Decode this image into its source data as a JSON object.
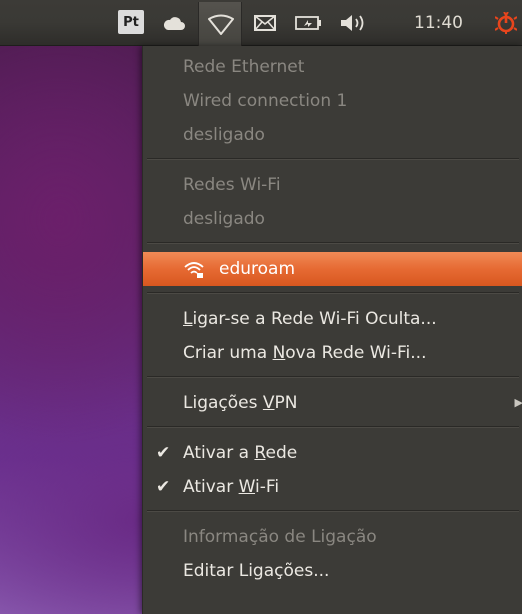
{
  "panel": {
    "indicators": [
      {
        "name": "keyboard-layout",
        "label": "Pt"
      },
      {
        "name": "cloud-icon"
      },
      {
        "name": "network-icon"
      },
      {
        "name": "mail-icon"
      },
      {
        "name": "battery-icon"
      },
      {
        "name": "volume-icon"
      },
      {
        "name": "session-icon"
      }
    ],
    "clock": "11:40",
    "colors": {
      "panel": "#3c3b37",
      "session": "#e8451c"
    }
  },
  "menu": {
    "ethernet_header": "Rede Ethernet",
    "ethernet_name": "Wired connection 1",
    "ethernet_status": "desligado",
    "wifi_header": "Redes Wi-Fi",
    "wifi_status": "desligado",
    "network_eduroam": "eduroam",
    "hidden_wifi": {
      "pre": "",
      "mnemonic": "L",
      "post": "igar-se a Rede Wi-Fi Oculta..."
    },
    "new_wifi": {
      "pre": "Criar uma ",
      "mnemonic": "N",
      "post": "ova Rede Wi-Fi..."
    },
    "vpn": {
      "pre": "Ligações ",
      "mnemonic": "V",
      "post": "PN"
    },
    "enable_network": {
      "pre": "Ativar a ",
      "mnemonic": "R",
      "post": "ede"
    },
    "enable_wifi": {
      "pre": "Ativar ",
      "mnemonic": "W",
      "post": "i-Fi"
    },
    "connection_info": "Informação de Ligação",
    "edit_connections": "Editar Ligações...",
    "highlight_color": "#e66a33"
  }
}
